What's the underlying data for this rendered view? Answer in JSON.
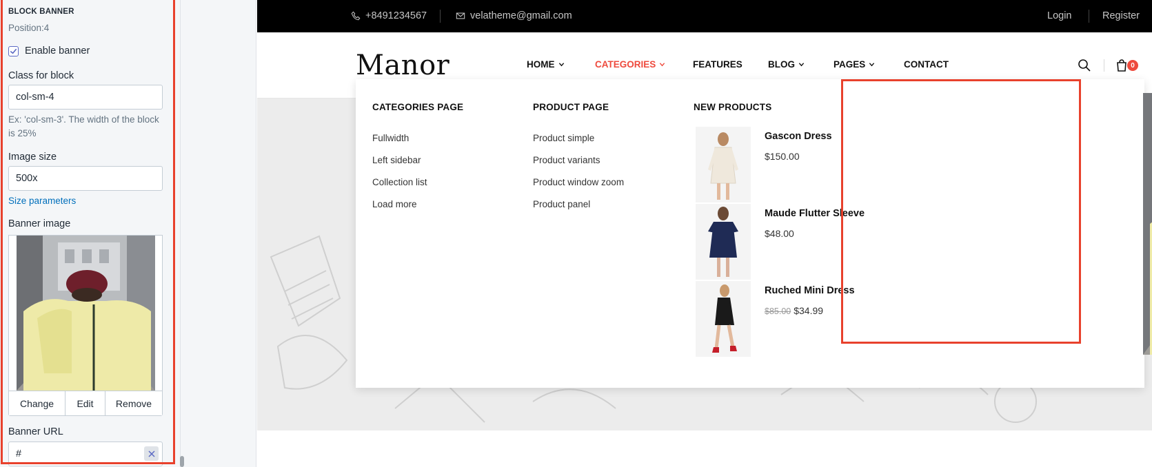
{
  "settings": {
    "heading": "BLOCK BANNER",
    "position": "Position:4",
    "enable_banner_label": "Enable banner",
    "enable_banner_checked": true,
    "class_label": "Class for block",
    "class_value": "col-sm-4",
    "class_help": "Ex: 'col-sm-3'. The width of the block is 25%",
    "image_size_label": "Image size",
    "image_size_value": "500x",
    "size_params_link": "Size parameters",
    "banner_image_label": "Banner image",
    "image_actions": {
      "change": "Change",
      "edit": "Edit",
      "remove": "Remove"
    },
    "banner_url_label": "Banner URL",
    "banner_url_value": "#",
    "highlight_color": "#e8412c"
  },
  "store": {
    "topbar": {
      "phone": "+8491234567",
      "email": "velatheme@gmail.com",
      "login": "Login",
      "register": "Register"
    },
    "logo": "Manor",
    "nav": [
      {
        "label": "HOME",
        "has_dropdown": true
      },
      {
        "label": "CATEGORIES",
        "has_dropdown": true,
        "active": true
      },
      {
        "label": "FEATURES",
        "has_dropdown": false
      },
      {
        "label": "BLOG",
        "has_dropdown": true
      },
      {
        "label": "PAGES",
        "has_dropdown": true
      },
      {
        "label": "CONTACT",
        "has_dropdown": false
      }
    ],
    "cart_count": "0",
    "accent_color": "#ee4a3d",
    "mega_menu": {
      "categories_title": "CATEGORIES PAGE",
      "categories_links": [
        "Fullwidth",
        "Left sidebar",
        "Collection list",
        "Load more"
      ],
      "product_title": "PRODUCT PAGE",
      "product_links": [
        "Product simple",
        "Product variants",
        "Product window zoom",
        "Product panel"
      ],
      "new_title": "NEW PRODUCTS",
      "new_products": [
        {
          "name": "Gascon Dress",
          "price": "$150.00",
          "old_price": ""
        },
        {
          "name": "Maude Flutter Sleeve",
          "price": "$48.00",
          "old_price": ""
        },
        {
          "name": "Ruched Mini Dress",
          "price": "$34.99",
          "old_price": "$85.00"
        }
      ]
    }
  }
}
